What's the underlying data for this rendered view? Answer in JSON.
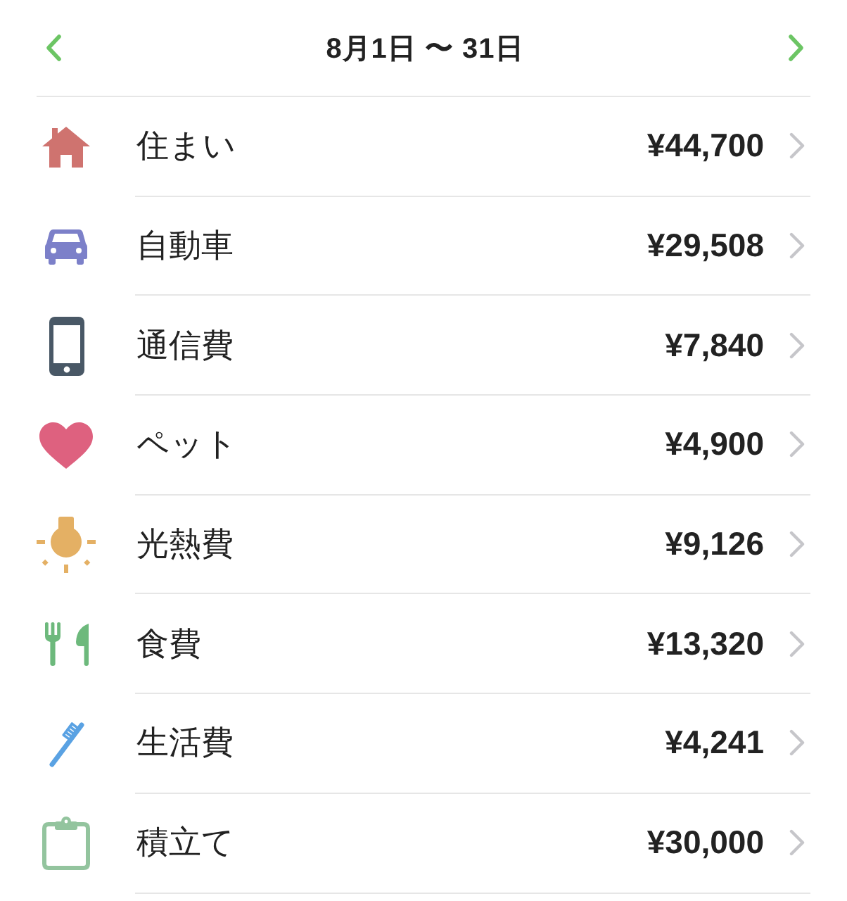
{
  "header": {
    "title": "8月1日 〜 31日"
  },
  "categories": [
    {
      "kind": "house",
      "color": "#cf736f",
      "name": "住まい",
      "amount": "¥44,700"
    },
    {
      "kind": "car",
      "color": "#7c80c9",
      "name": "自動車",
      "amount": "¥29,508"
    },
    {
      "kind": "phone",
      "color": "#495866",
      "name": "通信費",
      "amount": "¥7,840"
    },
    {
      "kind": "heart",
      "color": "#de617f",
      "name": "ペット",
      "amount": "¥4,900"
    },
    {
      "kind": "bulb",
      "color": "#e4b064",
      "name": "光熱費",
      "amount": "¥9,126"
    },
    {
      "kind": "cutlery",
      "color": "#6db97c",
      "name": "食費",
      "amount": "¥13,320"
    },
    {
      "kind": "toothbrush",
      "color": "#5aa2e3",
      "name": "生活費",
      "amount": "¥4,241"
    },
    {
      "kind": "clipboard",
      "color": "#93c49e",
      "name": "積立て",
      "amount": "¥30,000"
    }
  ]
}
